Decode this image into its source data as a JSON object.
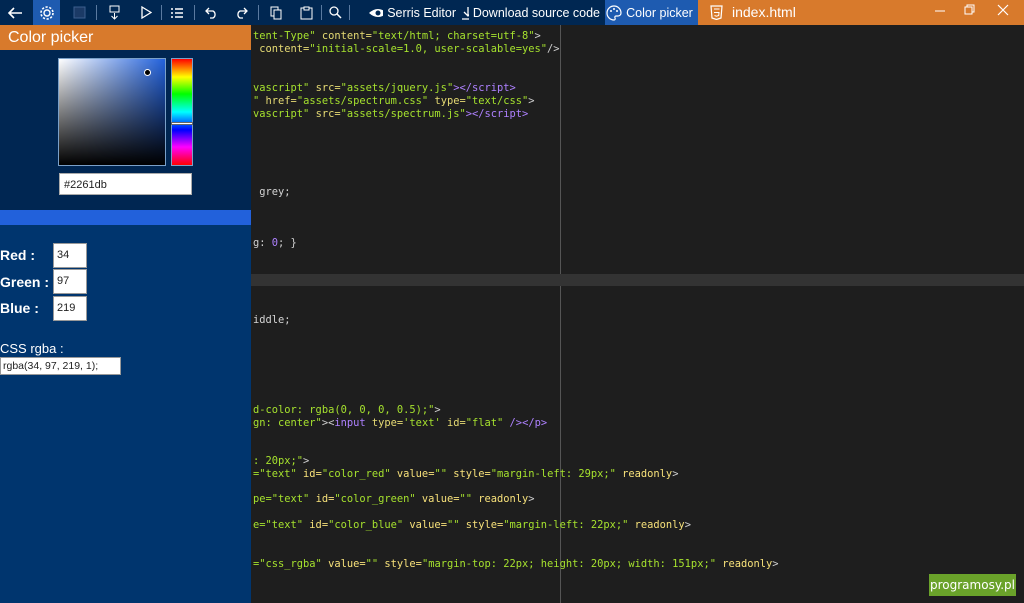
{
  "toolbar": {
    "serris_label": "Serris Editor",
    "download_label": "Download source code",
    "color_picker_label": "Color picker"
  },
  "tab": {
    "title": "index.html"
  },
  "panel": {
    "title": "Color picker",
    "hex_value": "#2261db",
    "selected_color": "#2261db",
    "red_label": "Red :",
    "green_label": "Green :",
    "blue_label": "Blue :",
    "red_value": "34",
    "green_value": "97",
    "blue_value": "219",
    "css_label": "CSS rgba :",
    "css_value": "rgba(34, 97, 219, 1);"
  },
  "code": {
    "l1a": "tent-Type\"",
    "l1b": " content=",
    "l1c": "\"text/html; charset=utf-8\"",
    "l1d": ">",
    "l2a": " content=",
    "l2b": "\"initial-scale=1.0, user-scalable=yes\"",
    "l2c": "/>",
    "l3a": "vascript\"",
    "l3b": " src=",
    "l3c": "\"assets/jquery.js\"",
    "l3d": "></",
    "l3e": "script",
    "l3f": ">",
    "l4a": "\"",
    "l4b": " href=",
    "l4c": "\"assets/spectrum.css\"",
    "l4d": " type=",
    "l4e": "\"text/css\"",
    "l4f": ">",
    "l5a": "vascript\"",
    "l5b": " src=",
    "l5c": "\"assets/spectrum.js\"",
    "l5d": "></",
    "l5e": "script",
    "l5f": ">",
    "l6": " grey;",
    "l7a": "g: ",
    "l7b": "0",
    "l7c": "; }",
    "l8": "iddle;",
    "l9a": "d-color: rgba(0, 0, 0, 0.5);\"",
    "l9b": ">",
    "l10a": "gn: center\"",
    "l10b": "><",
    "l10c": "input",
    "l10d": " type=",
    "l10e": "'text'",
    "l10f": " id=",
    "l10g": "\"flat\"",
    "l10h": " /></",
    "l10i": "p",
    "l10j": ">",
    "l11a": ": 20px;\"",
    "l11b": ">",
    "l12a": "=\"text\"",
    "l12b": " id=",
    "l12c": "\"color_red\"",
    "l12d": " value=",
    "l12e": "\"\"",
    "l12f": " style=",
    "l12g": "\"margin-left: 29px;\"",
    "l12h": " readonly",
    "l12i": ">",
    "l13a": "pe=\"text\"",
    "l13b": " id=",
    "l13c": "\"color_green\"",
    "l13d": " value=",
    "l13e": "\"\"",
    "l13f": " readonly",
    "l13g": ">",
    "l14a": "e=\"text\"",
    "l14b": " id=",
    "l14c": "\"color_blue\"",
    "l14d": " value=",
    "l14e": "\"\"",
    "l14f": " style=",
    "l14g": "\"margin-left: 22px;\"",
    "l14h": " readonly",
    "l14i": ">",
    "l15a": "=\"css_rgba\"",
    "l15b": " value=",
    "l15c": "\"\"",
    "l15d": " style=",
    "l15e": "\"margin-top: 22px; height: 20px; width: 151px;\"",
    "l15f": " readonly",
    "l15g": ">"
  },
  "watermark": "programosy.pl"
}
